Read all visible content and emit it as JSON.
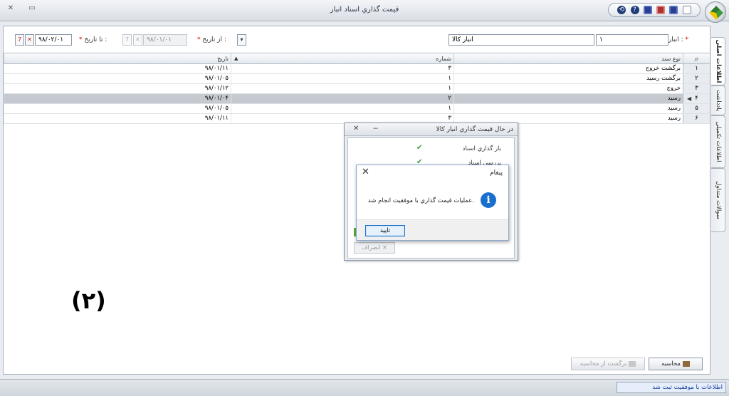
{
  "window": {
    "title": "قیمت گذاري اسناد انبار",
    "close_glyph": "✕",
    "restore_glyph": "▭"
  },
  "toolbar_icons": [
    "help-icon",
    "info-icon",
    "save-icon",
    "save-all-icon",
    "save-icon",
    "new-page-icon"
  ],
  "filters": {
    "warehouse_label": "انبار :",
    "warehouse_required": "*",
    "warehouse_code": "۱",
    "warehouse_name": "انبار كالا",
    "from_date_label": "از تاریخ :",
    "from_date_required": "*",
    "from_date_value": "۹۸/۰۱/۰۱",
    "to_date_label": "تا تاریخ :",
    "to_date_required": "*",
    "to_date_value": "۹۸/۰۲/۰۱"
  },
  "grid": {
    "columns": {
      "search_glyph": "🔍",
      "doc_type": "نوع سند",
      "number": "شماره",
      "date": "تاریخ"
    },
    "rows": [
      {
        "idx": "۱",
        "doc_type": "برگشت خروج",
        "number": "۳",
        "date": "۹۸/۰۱/۱۱"
      },
      {
        "idx": "۲",
        "doc_type": "برگشت رسید",
        "number": "۱",
        "date": "۹۸/۰۱/۰۵"
      },
      {
        "idx": "۳",
        "doc_type": "خروج",
        "number": "۱",
        "date": "۹۸/۰۱/۱۲"
      },
      {
        "idx": "۴",
        "doc_type": "رسید",
        "number": "۲",
        "date": "۹۸/۰۱/۰۴"
      },
      {
        "idx": "۵",
        "doc_type": "رسید",
        "number": "۱",
        "date": "۹۸/۰۱/۰۵"
      },
      {
        "idx": "۶",
        "doc_type": "رسید",
        "number": "۳",
        "date": "۹۸/۰۱/۱۱"
      }
    ],
    "selected_index": 3
  },
  "side_tabs": [
    "اطلاعات اصلی",
    "یادداشت",
    "اطلاعات تکمیلی",
    "سوالات متداول"
  ],
  "progress_dialog": {
    "title": "در حال قیمت گذاري انبار كالا",
    "close_glyph": "✕",
    "minimize_glyph": "‒",
    "steps": [
      "بار گذاري اسناد",
      "بررسی اسناد"
    ],
    "cancel_label": "انصراف"
  },
  "message_dialog": {
    "title": "پیغام",
    "close_glyph": "✕",
    "icon": "info-icon",
    "text": "عملیات قیمت گذاري با موفقیت انجام شد.",
    "ok_label": "تایید"
  },
  "big_label": "(۲)",
  "buttons": {
    "calculate": "محاسبه",
    "revert": "برگشت از محاسبه"
  },
  "status": {
    "message": "اطلاعات با موفقیت ثبت شد"
  },
  "colors": {
    "selected_row": "#c6c9cf",
    "required": "#d40000",
    "info_blue": "#1a6fce",
    "status_text": "#1b3f9c"
  }
}
